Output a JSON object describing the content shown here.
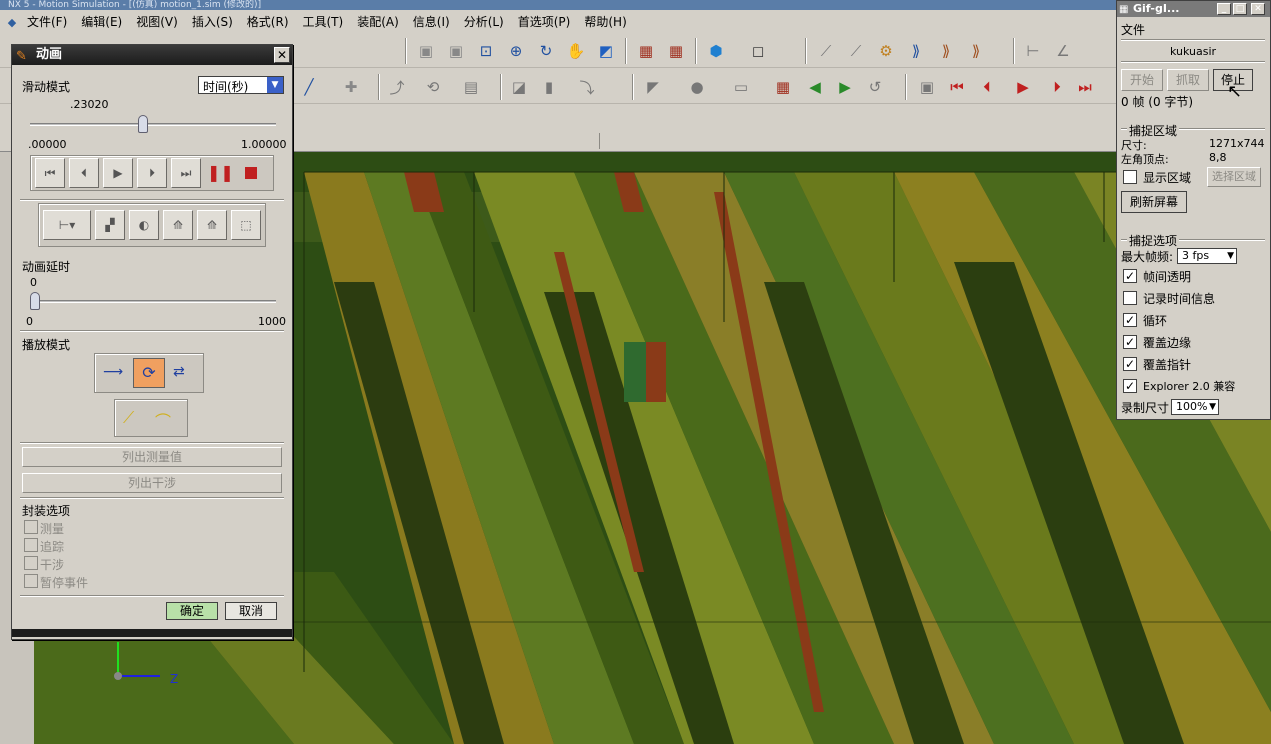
{
  "app": {
    "title": "NX 5 - Motion Simulation - [(仿真) motion_1.sim (修改的)]"
  },
  "menu": {
    "items": [
      {
        "label": "文件(F)"
      },
      {
        "label": "编辑(E)"
      },
      {
        "label": "视图(V)"
      },
      {
        "label": "插入(S)"
      },
      {
        "label": "格式(R)"
      },
      {
        "label": "工具(T)"
      },
      {
        "label": "装配(A)"
      },
      {
        "label": "信息(I)"
      },
      {
        "label": "分析(L)"
      },
      {
        "label": "首选项(P)"
      },
      {
        "label": "帮助(H)"
      }
    ]
  },
  "animation_dialog": {
    "title": "动画",
    "slide_mode_label": "滑动模式",
    "slide_mode_value": "时间(秒)",
    "slider_value": ".23020",
    "slider_fraction": 0.23,
    "slider_min": ".00000",
    "slider_max": "1.00000",
    "delay_label": "动画延时",
    "delay_value": "0",
    "delay_fraction": 0,
    "delay_min": "0",
    "delay_max": "1000",
    "play_mode_label": "播放模式",
    "list_measurements": "列出测量值",
    "list_interference": "列出干涉",
    "wrap_options_label": "封装选项",
    "wrap_options": [
      {
        "label": "测量"
      },
      {
        "label": "追踪"
      },
      {
        "label": "干涉"
      },
      {
        "label": "暂停事件"
      }
    ],
    "ok_label": "确定",
    "cancel_label": "取消"
  },
  "gif_panel": {
    "title": "Gif-gI...",
    "file_menu": "文件",
    "user": "kukuasir",
    "start_label": "开始",
    "grab_label": "抓取",
    "stop_label": "停止",
    "frame_status": "0 帧 (0 字节)",
    "capture_area_label": "捕捉区域",
    "size_label": "尺寸:",
    "size_value": "1271x744",
    "corner_label": "左角顶点:",
    "corner_value": "8,8",
    "show_area_label": "显示区域",
    "select_area_label": "选择区域",
    "refresh_label": "刷新屏幕",
    "capture_options_label": "捕捉选项",
    "max_fps_label": "最大帧频:",
    "max_fps_value": "3 fps",
    "options": [
      {
        "label": "帧间透明",
        "checked": true
      },
      {
        "label": "记录时间信息",
        "checked": false
      },
      {
        "label": "循环",
        "checked": true
      },
      {
        "label": "覆盖边缘",
        "checked": true
      },
      {
        "label": "覆盖指针",
        "checked": true
      },
      {
        "label": "Explorer 2.0 兼容",
        "checked": true
      }
    ],
    "record_size_label": "录制尺寸",
    "record_size_value": "100%"
  },
  "viewport": {
    "axis_label": "Z"
  }
}
